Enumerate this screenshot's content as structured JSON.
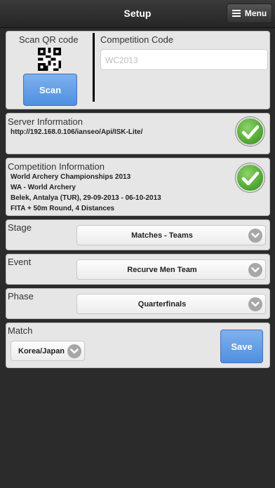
{
  "header": {
    "title": "Setup",
    "menu_label": "Menu"
  },
  "scan": {
    "label": "Scan QR code",
    "button": "Scan"
  },
  "competition_code": {
    "label": "Competition Code",
    "placeholder": "WC2013",
    "value": ""
  },
  "server": {
    "label": "Server Information",
    "url": "http://192.168.0.106/ianseo/Api/ISK-Lite/"
  },
  "competition": {
    "label": "Competition Information",
    "lines": [
      "World Archery Championships 2013",
      "WA - World Archery",
      "Belek, Antalya (TUR), 29-09-2013 - 06-10-2013",
      "FITA + 50m Round, 4 Distances"
    ]
  },
  "stage": {
    "label": "Stage",
    "value": "Matches - Teams"
  },
  "event": {
    "label": "Event",
    "value": "Recurve Men Team"
  },
  "phase": {
    "label": "Phase",
    "value": "Quarterfinals"
  },
  "match": {
    "label": "Match",
    "value": "Korea/Japan",
    "save": "Save"
  },
  "colors": {
    "accent": "#5f9be6",
    "success": "#4aa32d",
    "background": "#2b2b2b",
    "panel": "#e6e6e6"
  },
  "icons": {
    "menu": "hamburger-icon",
    "qr": "qr-code-icon",
    "ok": "check-icon",
    "dropdown": "chevron-down-icon"
  }
}
